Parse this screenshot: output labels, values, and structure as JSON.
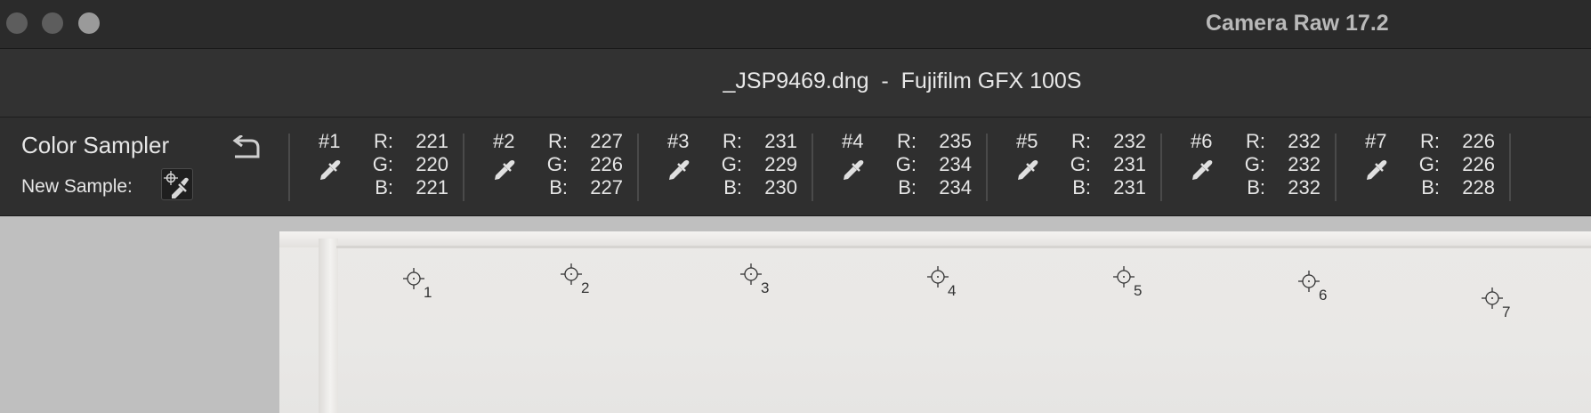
{
  "window": {
    "app_title": "Camera Raw 17.2",
    "document_title": "_JSP9469.dng  -  Fujifilm GFX 100S"
  },
  "sampler_panel": {
    "title": "Color Sampler",
    "new_sample_label": "New Sample:",
    "samples": [
      {
        "id": "#1",
        "r": "221",
        "g": "220",
        "b": "221"
      },
      {
        "id": "#2",
        "r": "227",
        "g": "226",
        "b": "227"
      },
      {
        "id": "#3",
        "r": "231",
        "g": "229",
        "b": "230"
      },
      {
        "id": "#4",
        "r": "235",
        "g": "234",
        "b": "234"
      },
      {
        "id": "#5",
        "r": "232",
        "g": "231",
        "b": "231"
      },
      {
        "id": "#6",
        "r": "232",
        "g": "232",
        "b": "232"
      },
      {
        "id": "#7",
        "r": "226",
        "g": "226",
        "b": "228"
      }
    ],
    "channel_labels": {
      "r": "R:",
      "g": "G:",
      "b": "B:"
    }
  },
  "canvas": {
    "markers": [
      "1",
      "2",
      "3",
      "4",
      "5",
      "6",
      "7"
    ]
  },
  "icons": {
    "undo": "undo-icon",
    "eyedropper": "eyedropper-icon",
    "new_sample": "color-sampler-add-icon",
    "marker": "crosshair-icon"
  },
  "colors": {
    "titlebar": "#2b2b2b",
    "panel": "#2f2f2f",
    "text": "#e6e6e6"
  }
}
